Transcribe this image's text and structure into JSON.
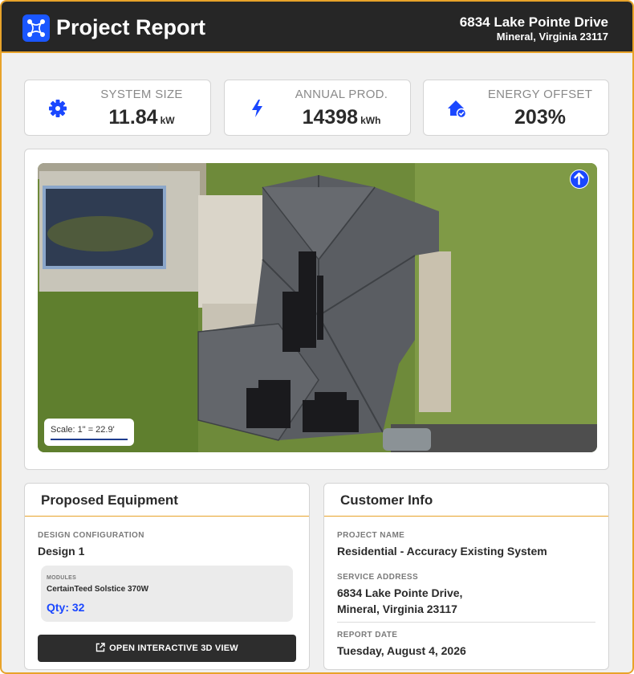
{
  "header": {
    "title": "Project Report",
    "address_line1": "6834 Lake Pointe Drive",
    "address_line2": "Mineral, Virginia 23117",
    "logo_icon": "network-nodes-icon",
    "brand_color": "#1a56ff",
    "accent_color": "#e8a32a"
  },
  "stats": [
    {
      "label": "SYSTEM SIZE",
      "value": "11.84",
      "unit": "kW",
      "icon": "gear-icon"
    },
    {
      "label": "ANNUAL PROD.",
      "value": "14398",
      "unit": "kWh",
      "icon": "lightning-bolt-icon"
    },
    {
      "label": "ENERGY OFFSET",
      "value": "203%",
      "unit": "",
      "icon": "house-check-icon"
    }
  ],
  "aerial": {
    "scale_text": "Scale: 1\" = 22.9'",
    "north_icon": "north-arrow-icon"
  },
  "equipment": {
    "heading": "Proposed Equipment",
    "design_config_label": "DESIGN CONFIGURATION",
    "design_config_value": "Design 1",
    "modules_label": "MODULES",
    "module_name": "CertainTeed Solstice 370W",
    "module_qty": "Qty: 32",
    "open_3d_label": "OPEN INTERACTIVE 3D VIEW"
  },
  "customer": {
    "heading": "Customer Info",
    "project_name_label": "PROJECT NAME",
    "project_name_value": "Residential - Accuracy Existing System",
    "service_address_label": "SERVICE ADDRESS",
    "service_address_line1": "6834 Lake Pointe Drive,",
    "service_address_line2": "Mineral, Virginia 23117",
    "report_date_label": "REPORT DATE",
    "report_date_value": "Tuesday, August 4, 2026"
  }
}
